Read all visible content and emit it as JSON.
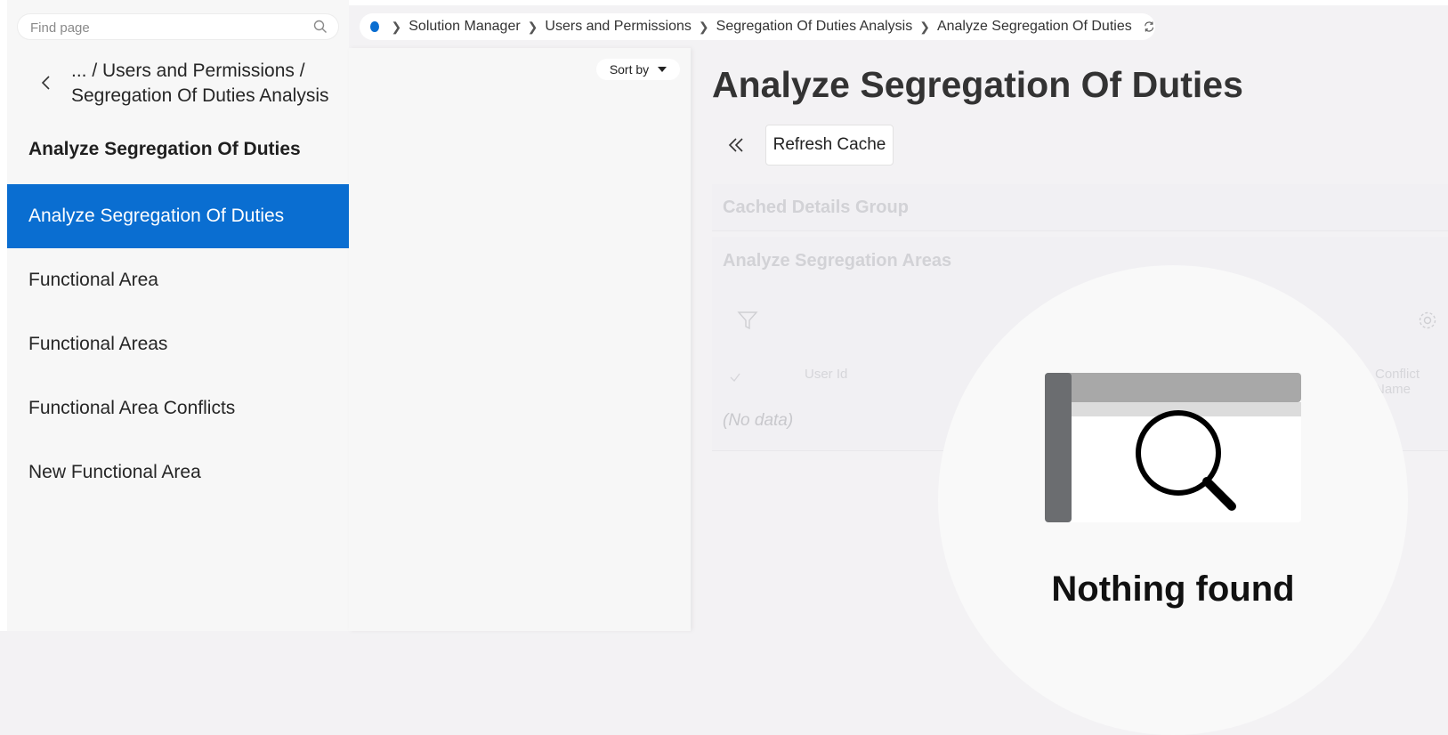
{
  "sidebar": {
    "search_placeholder": "Find page",
    "path_line1": "... / Users and Permissions /",
    "path_line2": "Segregation Of Duties Analysis",
    "section_title": "Analyze Segregation Of Duties",
    "items": [
      {
        "label": "Analyze Segregation Of Duties",
        "active": true
      },
      {
        "label": "Functional Area",
        "active": false
      },
      {
        "label": "Functional Areas",
        "active": false
      },
      {
        "label": "Functional Area Conflicts",
        "active": false
      },
      {
        "label": "New Functional Area",
        "active": false
      }
    ]
  },
  "breadcrumb": {
    "items": [
      "Solution Manager",
      "Users and Permissions",
      "Segregation Of Duties Analysis",
      "Analyze Segregation Of Duties"
    ]
  },
  "list_panel": {
    "sort_label": "Sort by"
  },
  "main": {
    "title": "Analyze Segregation Of Duties",
    "refresh_label": "Refresh Cache",
    "group_cached": "Cached Details Group",
    "group_areas": "Analyze Segregation Areas",
    "col_user_id": "User Id",
    "col_conflict_name": "Conflict Name",
    "no_data": "(No data)"
  },
  "empty_state": {
    "message": "Nothing found"
  },
  "colors": {
    "accent": "#0a6ed1",
    "background": "#f3f2f4",
    "panel": "#f7f7f7"
  }
}
